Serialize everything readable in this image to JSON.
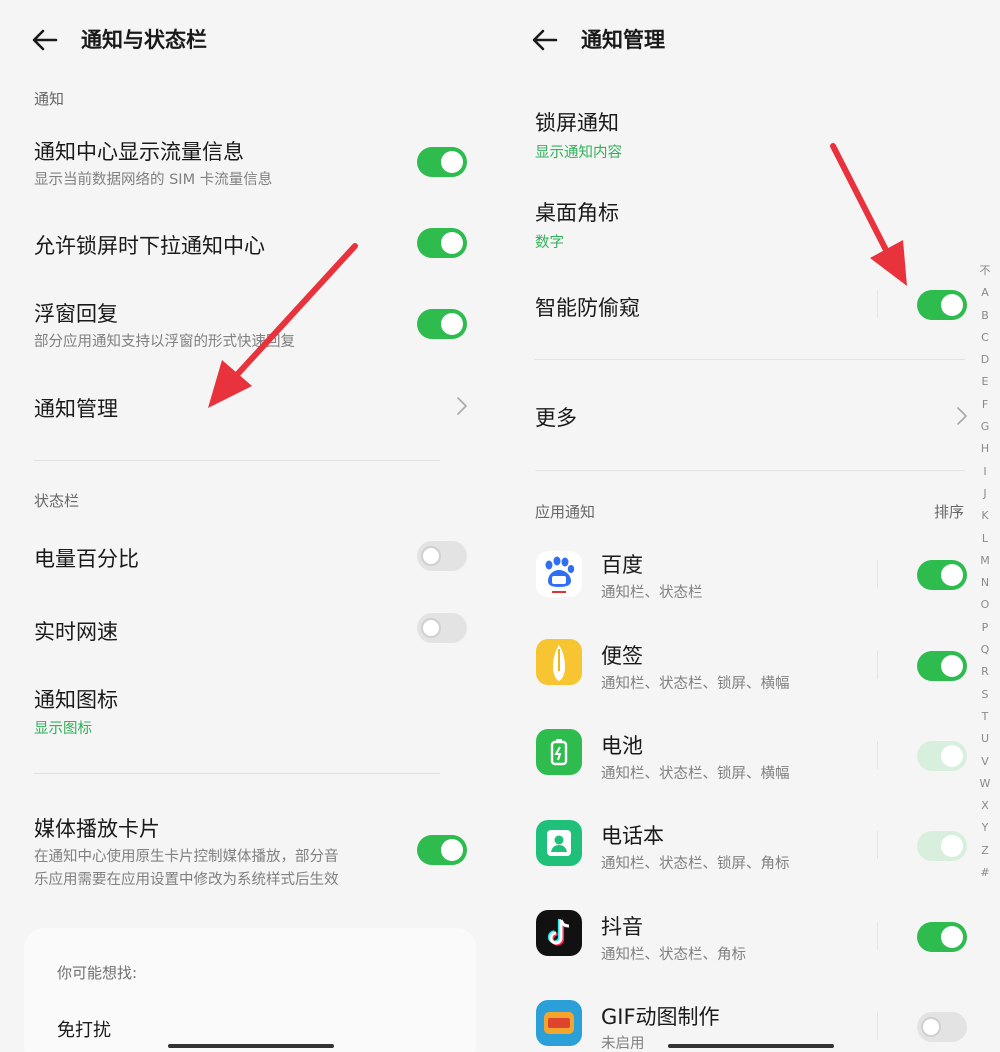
{
  "left": {
    "title": "通知与状态栏",
    "section_notify": "通知",
    "items": [
      {
        "title": "通知中心显示流量信息",
        "sub": "显示当前数据网络的 SIM 卡流量信息",
        "toggle": true
      },
      {
        "title": "允许锁屏时下拉通知中心",
        "toggle": true
      },
      {
        "title": "浮窗回复",
        "sub": "部分应用通知支持以浮窗的形式快速回复",
        "toggle": true
      },
      {
        "title": "通知管理"
      }
    ],
    "section_status": "状态栏",
    "status_items": [
      {
        "title": "电量百分比",
        "toggle": false
      },
      {
        "title": "实时网速",
        "toggle": false
      },
      {
        "title": "通知图标",
        "value": "显示图标"
      }
    ],
    "media": {
      "title": "媒体播放卡片",
      "sub_line1": "在通知中心使用原生卡片控制媒体播放，部分音",
      "sub_line2": "乐应用需要在应用设置中修改为系统样式后生效",
      "toggle": true
    },
    "card": {
      "heading": "你可能想找:",
      "item": "免打扰"
    }
  },
  "right": {
    "title": "通知管理",
    "items": [
      {
        "title": "锁屏通知",
        "value": "显示通知内容"
      },
      {
        "title": "桌面角标",
        "value": "数字"
      },
      {
        "title": "智能防偷窥",
        "toggle": true
      },
      {
        "title": "更多"
      }
    ],
    "section_apps": "应用通知",
    "sort_label": "排序",
    "apps": [
      {
        "name": "百度",
        "desc": "通知栏、状态栏",
        "icon": "baidu-icon",
        "toggle": "on"
      },
      {
        "name": "便签",
        "desc": "通知栏、状态栏、锁屏、横幅",
        "icon": "notes-icon",
        "toggle": "on"
      },
      {
        "name": "电池",
        "desc": "通知栏、状态栏、锁屏、横幅",
        "icon": "battery-icon",
        "toggle": "dim"
      },
      {
        "name": "电话本",
        "desc": "通知栏、状态栏、锁屏、角标",
        "icon": "contacts-icon",
        "toggle": "dim"
      },
      {
        "name": "抖音",
        "desc": "通知栏、状态栏、角标",
        "icon": "douyin-icon",
        "toggle": "on"
      },
      {
        "name": "GIF动图制作",
        "desc": "未启用",
        "icon": "gif-maker-icon",
        "toggle": "off"
      }
    ],
    "alphabet": [
      "不",
      "A",
      "B",
      "C",
      "D",
      "E",
      "F",
      "G",
      "H",
      "I",
      "J",
      "K",
      "L",
      "M",
      "N",
      "O",
      "P",
      "Q",
      "R",
      "S",
      "T",
      "U",
      "V",
      "W",
      "X",
      "Y",
      "Z",
      "#"
    ]
  },
  "colors": {
    "accent_green": "#2ebc4f",
    "arrow_red": "#e8323c",
    "background": "#f5f5f5"
  }
}
